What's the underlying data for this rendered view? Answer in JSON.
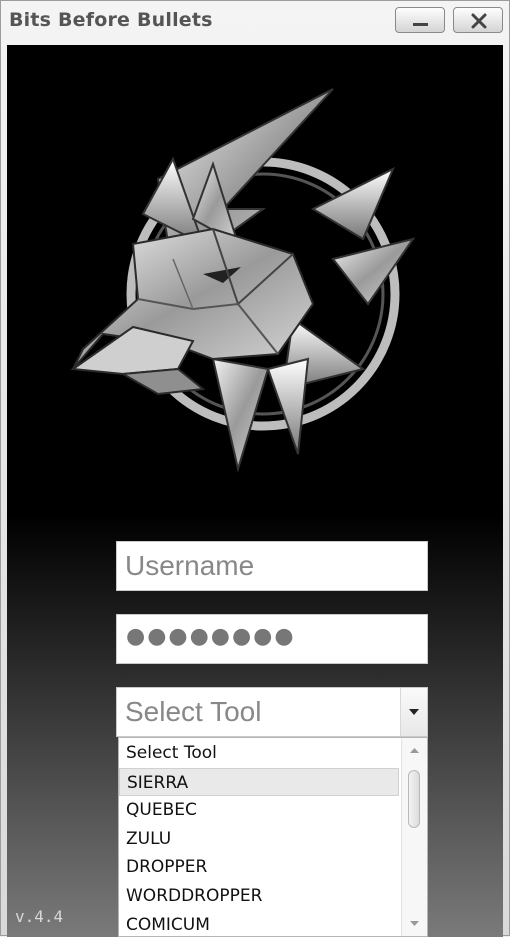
{
  "window": {
    "title": "Bits Before Bullets",
    "minimize_icon": "minimize-icon",
    "close_icon": "close-icon"
  },
  "logo": {
    "icon": "wolf-emblem-logo"
  },
  "form": {
    "username_placeholder": "Username",
    "password_mask": "●●●●●●●●",
    "tool_select_value": "Select Tool",
    "dropdown_icon": "chevron-down-icon"
  },
  "tool_options": [
    {
      "label": "Select Tool"
    },
    {
      "label": "SIERRA",
      "highlighted": true
    },
    {
      "label": "QUEBEC"
    },
    {
      "label": "ZULU"
    },
    {
      "label": "DROPPER"
    },
    {
      "label": "WORDDROPPER"
    },
    {
      "label": "COMICUM"
    }
  ],
  "version": "v.4.4",
  "colors": {
    "background_top": "#000000",
    "background_bottom": "#7a7a7a",
    "option_highlight": "#e9e9e9"
  }
}
